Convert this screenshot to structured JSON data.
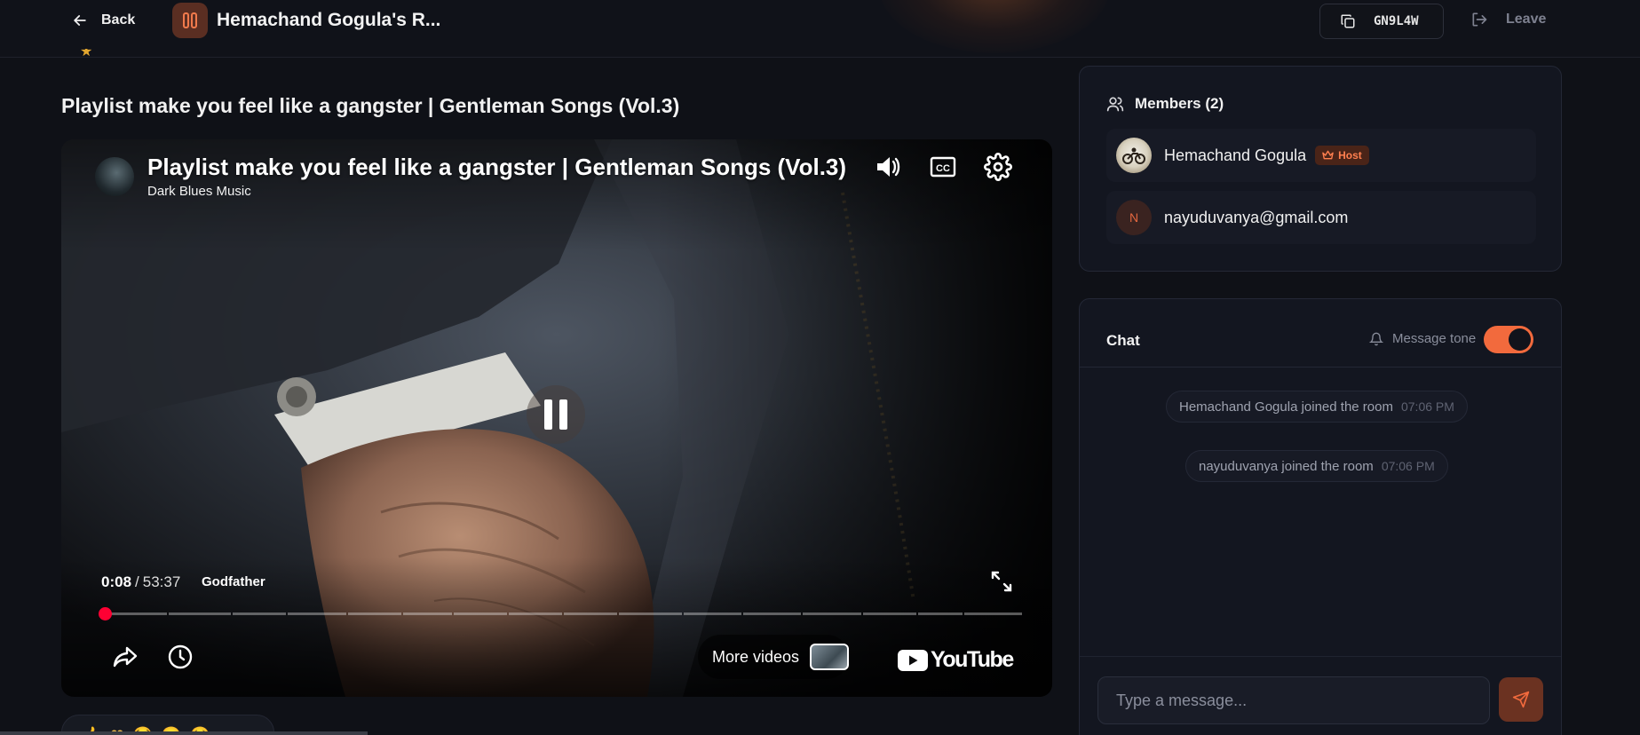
{
  "colors": {
    "accent": "#f26a3d",
    "background": "#0f1117",
    "card": "#131620",
    "youtube_red": "#ff0033"
  },
  "header": {
    "back_label": "Back",
    "room_title": "Hemachand Gogula's R...",
    "room_code": "GN9L4W",
    "leave_label": "Leave",
    "icons": [
      "arrow-left-icon",
      "pause-icon",
      "copy-icon",
      "logout-icon"
    ]
  },
  "video": {
    "page_title": "Playlist make you feel like a gangster | Gentleman Songs (Vol.3)",
    "player": {
      "title": "Playlist make you feel like a gangster | Gentleman Songs (Vol.3)",
      "channel": "Dark Blues Music",
      "current_time": "0:08",
      "separator": "/",
      "duration": "53:37",
      "chapter": "Godfather",
      "progress_fraction": 0.0025,
      "more_videos_label": "More videos",
      "brand_label": "YouTube",
      "state": "playing",
      "icons": [
        "volume-icon",
        "captions-icon",
        "settings-icon",
        "pause-icon",
        "fullscreen-icon",
        "share-icon",
        "watch-later-icon",
        "youtube-logo-icon"
      ]
    }
  },
  "members": {
    "title": "Members (2)",
    "list": [
      {
        "name": "Hemachand Gogula",
        "badge": "Host",
        "avatar": "photo"
      },
      {
        "name": "nayuduvanya@gmail.com",
        "avatar_letter": "N"
      }
    ]
  },
  "chat": {
    "title": "Chat",
    "tone_label": "Message tone",
    "tone_enabled": true,
    "messages": [
      {
        "text": "Hemachand Gogula joined the room",
        "time": "07:06 PM"
      },
      {
        "text": "nayuduvanya joined the room",
        "time": "07:06 PM"
      }
    ],
    "input_placeholder": "Type a message...",
    "input_value": ""
  }
}
